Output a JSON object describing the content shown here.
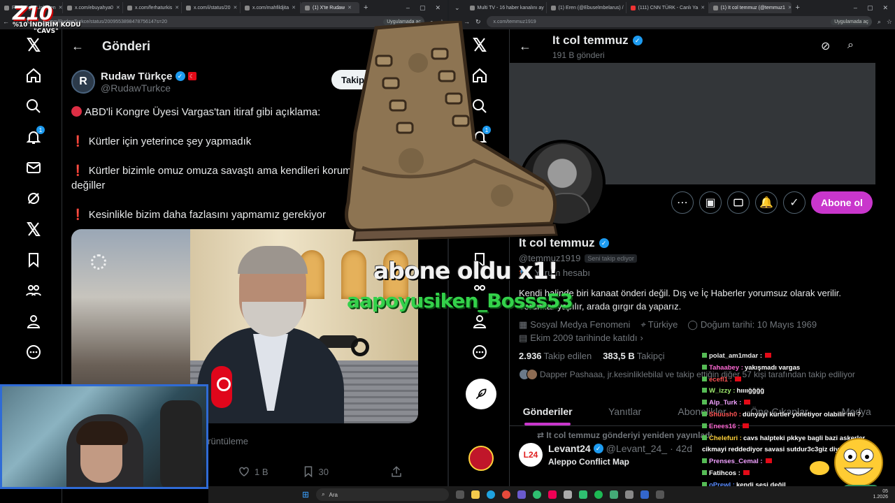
{
  "logo": {
    "big": "Z10",
    "line1": "%10 İNDİRİM KODU",
    "line2": "\"CAVS\""
  },
  "left_browser": {
    "tabs": [
      {
        "label": "FlashSight Link Den",
        "active": false
      },
      {
        "label": "x.com/ebuyahya0",
        "active": false
      },
      {
        "label": "x.com/ferhaturkis",
        "active": false
      },
      {
        "label": "x.com/i/status/20",
        "active": false
      },
      {
        "label": "x.com/mahfildjita",
        "active": false
      },
      {
        "label": "(1) X'te Rudaw",
        "active": true
      }
    ],
    "url": "x.com/RudawTurkce/status/2009553898478756147s=20",
    "app_pill": "Uygulamada aç"
  },
  "right_browser": {
    "tabs": [
      {
        "label": "Multi TV - 16 haber kanalını ay",
        "active": false
      },
      {
        "label": "(1) Eren (@Ebuselmbelarus) /",
        "active": false
      },
      {
        "label": "(111) CNN TÜRK - Canlı Ya",
        "active": false
      },
      {
        "label": "(1) It col temmuz (@temmuz1",
        "active": true
      }
    ],
    "url": "x.com/temmuz1919",
    "app_pill": "Uygulamada aç"
  },
  "left_nav": {
    "notification_count": "1",
    "icons": [
      "x-logo-icon",
      "home-icon",
      "search-icon",
      "bell-icon",
      "mail-icon",
      "grok-icon",
      "x-premium-icon",
      "bookmark-icon",
      "communities-icon",
      "profile-icon",
      "more-icon"
    ]
  },
  "post": {
    "header": "Gönderi",
    "author_name": "Rudaw Türkçe",
    "author_handle": "@RudawTurkce",
    "avatar_letter": "R",
    "follow_label": "Takip et",
    "lines": [
      "ABD'li Kongre Üyesi Vargas'tan itiraf gibi açıklama:",
      "Kürtler için yeterince şey yapmadık",
      "Kürtler bizimle omuz omuza savaştı ama kendileri korum",
      "değiller",
      "Kesinlikle bizim daha fazlasını yapmamız gerekiyor"
    ],
    "views_label": "örüntüleme",
    "likes": "1 B",
    "bookmarks": "30"
  },
  "profile": {
    "name": "It col temmuz",
    "post_count": "191 B gönderi",
    "handle": "@temmuz1919",
    "follows_you": "Seni takip ediyor",
    "account_type": "Yorum hesabı",
    "bio": "Kendi halinde biri  kanaat önderi değil. Dış ve İç Haberler yorumsuz olarak verilir. Yorumlar yapılır, arada gırgır da yaparız.",
    "category": "Sosyal Medya Fenomeni",
    "location": "Türkiye",
    "birthday": "Doğum tarihi: 10 Mayıs 1969",
    "joined": "Ekim 2009 tarihinde katıldı",
    "following_count": "2.936",
    "following_label": "Takip edilen",
    "followers_count": "383,5 B",
    "followers_label": "Takipçi",
    "known_followers": "Dapper Pashaaa, jr.kesinliklebilal ve takip ettiğin diğer 57 kişi tarafından takip ediliyor",
    "subscribe_label": "Abone ol",
    "tabs": [
      "Gönderiler",
      "Yanıtlar",
      "Abonelikler",
      "Öne Çıkanlar",
      "Medya"
    ],
    "repost_note": "It col temmuz gönderiyi yeniden yayınladı",
    "tweet_author": "Levant24",
    "tweet_handle": "@Levant_24_",
    "tweet_age": "· 42d",
    "tweet_text": "Aleppo Conflict Map",
    "tweet_avatar": "L24"
  },
  "alerts": {
    "line1": "abone oldu x1!",
    "line2": "aapoyusiken_Bosss53"
  },
  "chat": [
    {
      "user": "polat_am1mdar :",
      "msg": "",
      "c": "c1",
      "flag": true
    },
    {
      "user": "Tahaabey :",
      "msg": "yakışmadı vargas",
      "c": "c2",
      "flag": false
    },
    {
      "user": "ecefl1 :",
      "msg": "",
      "c": "c4",
      "flag": true
    },
    {
      "user": "W_izzy :",
      "msg": "hıııığğğğ",
      "c": "c3",
      "flag": false
    },
    {
      "user": "Alp_Turk :",
      "msg": "",
      "c": "c7",
      "flag": true
    },
    {
      "user": "Shuush0 :",
      "msg": "dünyayı kürtler yönetiyor olabilir mi ?",
      "c": "c4",
      "flag": false
    },
    {
      "user": "Enees16 :",
      "msg": "",
      "c": "c2",
      "flag": true
    },
    {
      "user": "Chelefuri :",
      "msg": "cavs halpteki pkkye bagli bazi askerler cikmayi reddediyor savasi sutdur3c3giz diyor @cavs",
      "c": "c5",
      "flag": false
    },
    {
      "user": "Prenses_Cemal :",
      "msg": "",
      "c": "c7",
      "flag": true
    },
    {
      "user": "Fatihcos :",
      "msg": "",
      "c": "c8",
      "flag": true
    },
    {
      "user": "oPrewl :",
      "msg": "kendi sesi değil",
      "c": "c9",
      "flag": false
    }
  ],
  "taskbar": {
    "search": "Ara",
    "clock_line1": "05",
    "clock_line2": "1.2026"
  },
  "colors": {
    "accent": "#c936cc",
    "verified": "#1d9bf0",
    "alert_green": "#33d14a",
    "webcam_border": "#2f6bd6"
  }
}
